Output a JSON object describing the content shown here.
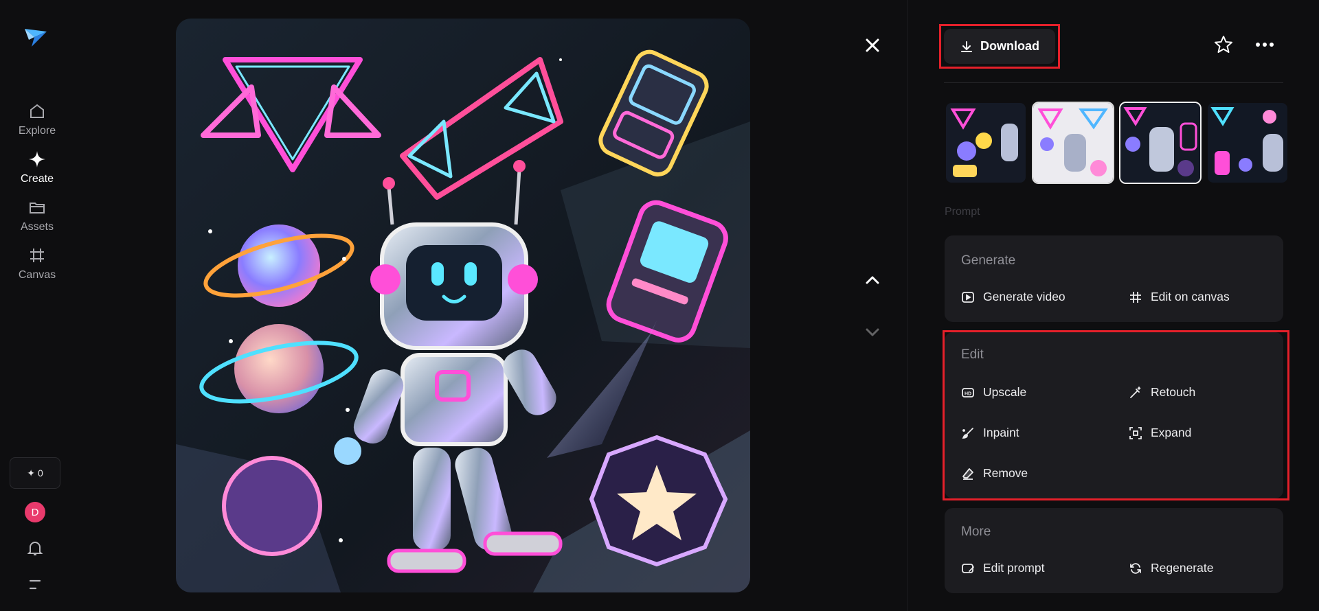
{
  "nav": {
    "items": [
      {
        "label": "Explore",
        "icon": "home-icon"
      },
      {
        "label": "Create",
        "icon": "sparkle-icon",
        "active": true
      },
      {
        "label": "Assets",
        "icon": "folder-icon"
      },
      {
        "label": "Canvas",
        "icon": "frame-icon"
      }
    ],
    "credits": "0",
    "avatar_initial": "D"
  },
  "toolbar": {
    "download_label": "Download"
  },
  "panel": {
    "prompt_label": "Prompt",
    "generate": {
      "title": "Generate",
      "actions": [
        "Generate video",
        "Edit on canvas"
      ]
    },
    "edit": {
      "title": "Edit",
      "actions": [
        "Upscale",
        "Retouch",
        "Inpaint",
        "Expand",
        "Remove"
      ]
    },
    "more": {
      "title": "More",
      "actions": [
        "Edit prompt",
        "Regenerate"
      ]
    }
  },
  "colors": {
    "highlight": "#e5202a",
    "accent_blue": "#3aa7ff",
    "avatar": "#e93a6c"
  }
}
